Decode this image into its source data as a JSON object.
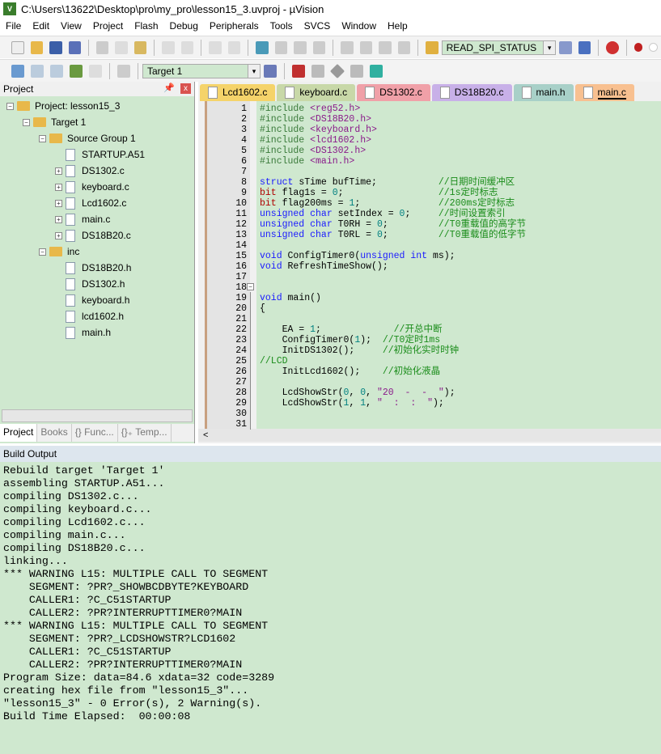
{
  "window": {
    "title": "C:\\Users\\13622\\Desktop\\pro\\my_pro\\lesson15_3.uvproj - µVision"
  },
  "menu": [
    "File",
    "Edit",
    "View",
    "Project",
    "Flash",
    "Debug",
    "Peripherals",
    "Tools",
    "SVCS",
    "Window",
    "Help"
  ],
  "toolbar": {
    "find_combo": "READ_SPI_STATUS",
    "target_combo": "Target 1"
  },
  "project": {
    "title": "Project",
    "root": "Project: lesson15_3",
    "target": "Target 1",
    "groups": [
      {
        "name": "Source Group 1",
        "files": [
          "STARTUP.A51",
          "DS1302.c",
          "keyboard.c",
          "Lcd1602.c",
          "main.c",
          "DS18B20.c"
        ]
      },
      {
        "name": "inc",
        "files": [
          "DS18B20.h",
          "DS1302.h",
          "keyboard.h",
          "lcd1602.h",
          "main.h"
        ]
      }
    ],
    "tabs": [
      "Project",
      "Books",
      "{} Func...",
      "{}₊ Temp..."
    ]
  },
  "editor": {
    "tabs": [
      {
        "label": "Lcd1602.c",
        "color": "#f5d36a"
      },
      {
        "label": "keyboard.c",
        "color": "#c8d8a8"
      },
      {
        "label": "DS1302.c",
        "color": "#f0a0a8"
      },
      {
        "label": "DS18B20.c",
        "color": "#c8b0e8"
      },
      {
        "label": "main.h",
        "color": "#a8d0c8"
      },
      {
        "label": "main.c",
        "color": "#f8c090",
        "active": true
      }
    ],
    "lines": [
      [
        [
          "p",
          "#include "
        ],
        [
          "s",
          "<reg52.h>"
        ]
      ],
      [
        [
          "p",
          "#include "
        ],
        [
          "s",
          "<DS18B20.h>"
        ]
      ],
      [
        [
          "p",
          "#include "
        ],
        [
          "s",
          "<keyboard.h>"
        ]
      ],
      [
        [
          "p",
          "#include "
        ],
        [
          "s",
          "<lcd1602.h>"
        ]
      ],
      [
        [
          "p",
          "#include "
        ],
        [
          "s",
          "<DS1302.h>"
        ]
      ],
      [
        [
          "p",
          "#include "
        ],
        [
          "s",
          "<main.h>"
        ]
      ],
      [],
      [
        [
          "k",
          "struct"
        ],
        [
          "x",
          " sTime bufTime;           "
        ],
        [
          "c",
          "//日期时间缓冲区"
        ]
      ],
      [
        [
          "r",
          "bit"
        ],
        [
          "x",
          " flag1s = "
        ],
        [
          "n",
          "0"
        ],
        [
          "x",
          ";                 "
        ],
        [
          "c",
          "//1s定时标志"
        ]
      ],
      [
        [
          "r",
          "bit"
        ],
        [
          "x",
          " flag200ms = "
        ],
        [
          "n",
          "1"
        ],
        [
          "x",
          ";              "
        ],
        [
          "c",
          "//200ms定时标志"
        ]
      ],
      [
        [
          "k",
          "unsigned char"
        ],
        [
          "x",
          " setIndex = "
        ],
        [
          "n",
          "0"
        ],
        [
          "x",
          ";     "
        ],
        [
          "c",
          "//时间设置索引"
        ]
      ],
      [
        [
          "k",
          "unsigned char"
        ],
        [
          "x",
          " T0RH = "
        ],
        [
          "n",
          "0"
        ],
        [
          "x",
          ";         "
        ],
        [
          "c",
          "//T0重载值的高字节"
        ]
      ],
      [
        [
          "k",
          "unsigned char"
        ],
        [
          "x",
          " T0RL = "
        ],
        [
          "n",
          "0"
        ],
        [
          "x",
          ";         "
        ],
        [
          "c",
          "//T0重载值的低字节"
        ]
      ],
      [],
      [
        [
          "k",
          "void"
        ],
        [
          "x",
          " ConfigTimer0("
        ],
        [
          "k",
          "unsigned int"
        ],
        [
          "x",
          " ms);"
        ]
      ],
      [
        [
          "k",
          "void"
        ],
        [
          "x",
          " RefreshTimeShow();"
        ]
      ],
      [],
      [],
      [
        [
          "k",
          "void"
        ],
        [
          "x",
          " main()"
        ]
      ],
      [
        [
          "x",
          "{"
        ]
      ],
      [],
      [
        [
          "x",
          "    EA = "
        ],
        [
          "n",
          "1"
        ],
        [
          "x",
          ";             "
        ],
        [
          "c",
          "//开总中断"
        ]
      ],
      [
        [
          "x",
          "    ConfigTimer0("
        ],
        [
          "n",
          "1"
        ],
        [
          "x",
          ");  "
        ],
        [
          "c",
          "//T0定时1ms"
        ]
      ],
      [
        [
          "x",
          "    InitDS1302();     "
        ],
        [
          "c",
          "//初始化实时时钟"
        ]
      ],
      [
        [
          "c",
          "//LCD"
        ]
      ],
      [
        [
          "x",
          "    InitLcd1602();    "
        ],
        [
          "c",
          "//初始化液晶"
        ]
      ],
      [],
      [
        [
          "x",
          "    LcdShowStr("
        ],
        [
          "n",
          "0"
        ],
        [
          "x",
          ", "
        ],
        [
          "n",
          "0"
        ],
        [
          "x",
          ", "
        ],
        [
          "q",
          "\"20  -  -  \""
        ],
        [
          "x",
          ");"
        ]
      ],
      [
        [
          "x",
          "    LcdShowStr("
        ],
        [
          "n",
          "1"
        ],
        [
          "x",
          ", "
        ],
        [
          "n",
          "1"
        ],
        [
          "x",
          ", "
        ],
        [
          "q",
          "\"  :  :  \""
        ],
        [
          "x",
          ");"
        ]
      ],
      [],
      []
    ]
  },
  "build": {
    "title": "Build Output",
    "lines": [
      "Rebuild target 'Target 1'",
      "assembling STARTUP.A51...",
      "compiling DS1302.c...",
      "compiling keyboard.c...",
      "compiling Lcd1602.c...",
      "compiling main.c...",
      "compiling DS18B20.c...",
      "linking...",
      "*** WARNING L15: MULTIPLE CALL TO SEGMENT",
      "    SEGMENT: ?PR?_SHOWBCDBYTE?KEYBOARD",
      "    CALLER1: ?C_C51STARTUP",
      "    CALLER2: ?PR?INTERRUPTTIMER0?MAIN",
      "*** WARNING L15: MULTIPLE CALL TO SEGMENT",
      "    SEGMENT: ?PR?_LCDSHOWSTR?LCD1602",
      "    CALLER1: ?C_C51STARTUP",
      "    CALLER2: ?PR?INTERRUPTTIMER0?MAIN",
      "Program Size: data=84.6 xdata=32 code=3289",
      "creating hex file from \"lesson15_3\"...",
      "\"lesson15_3\" - 0 Error(s), 2 Warning(s).",
      "Build Time Elapsed:  00:00:08"
    ]
  }
}
